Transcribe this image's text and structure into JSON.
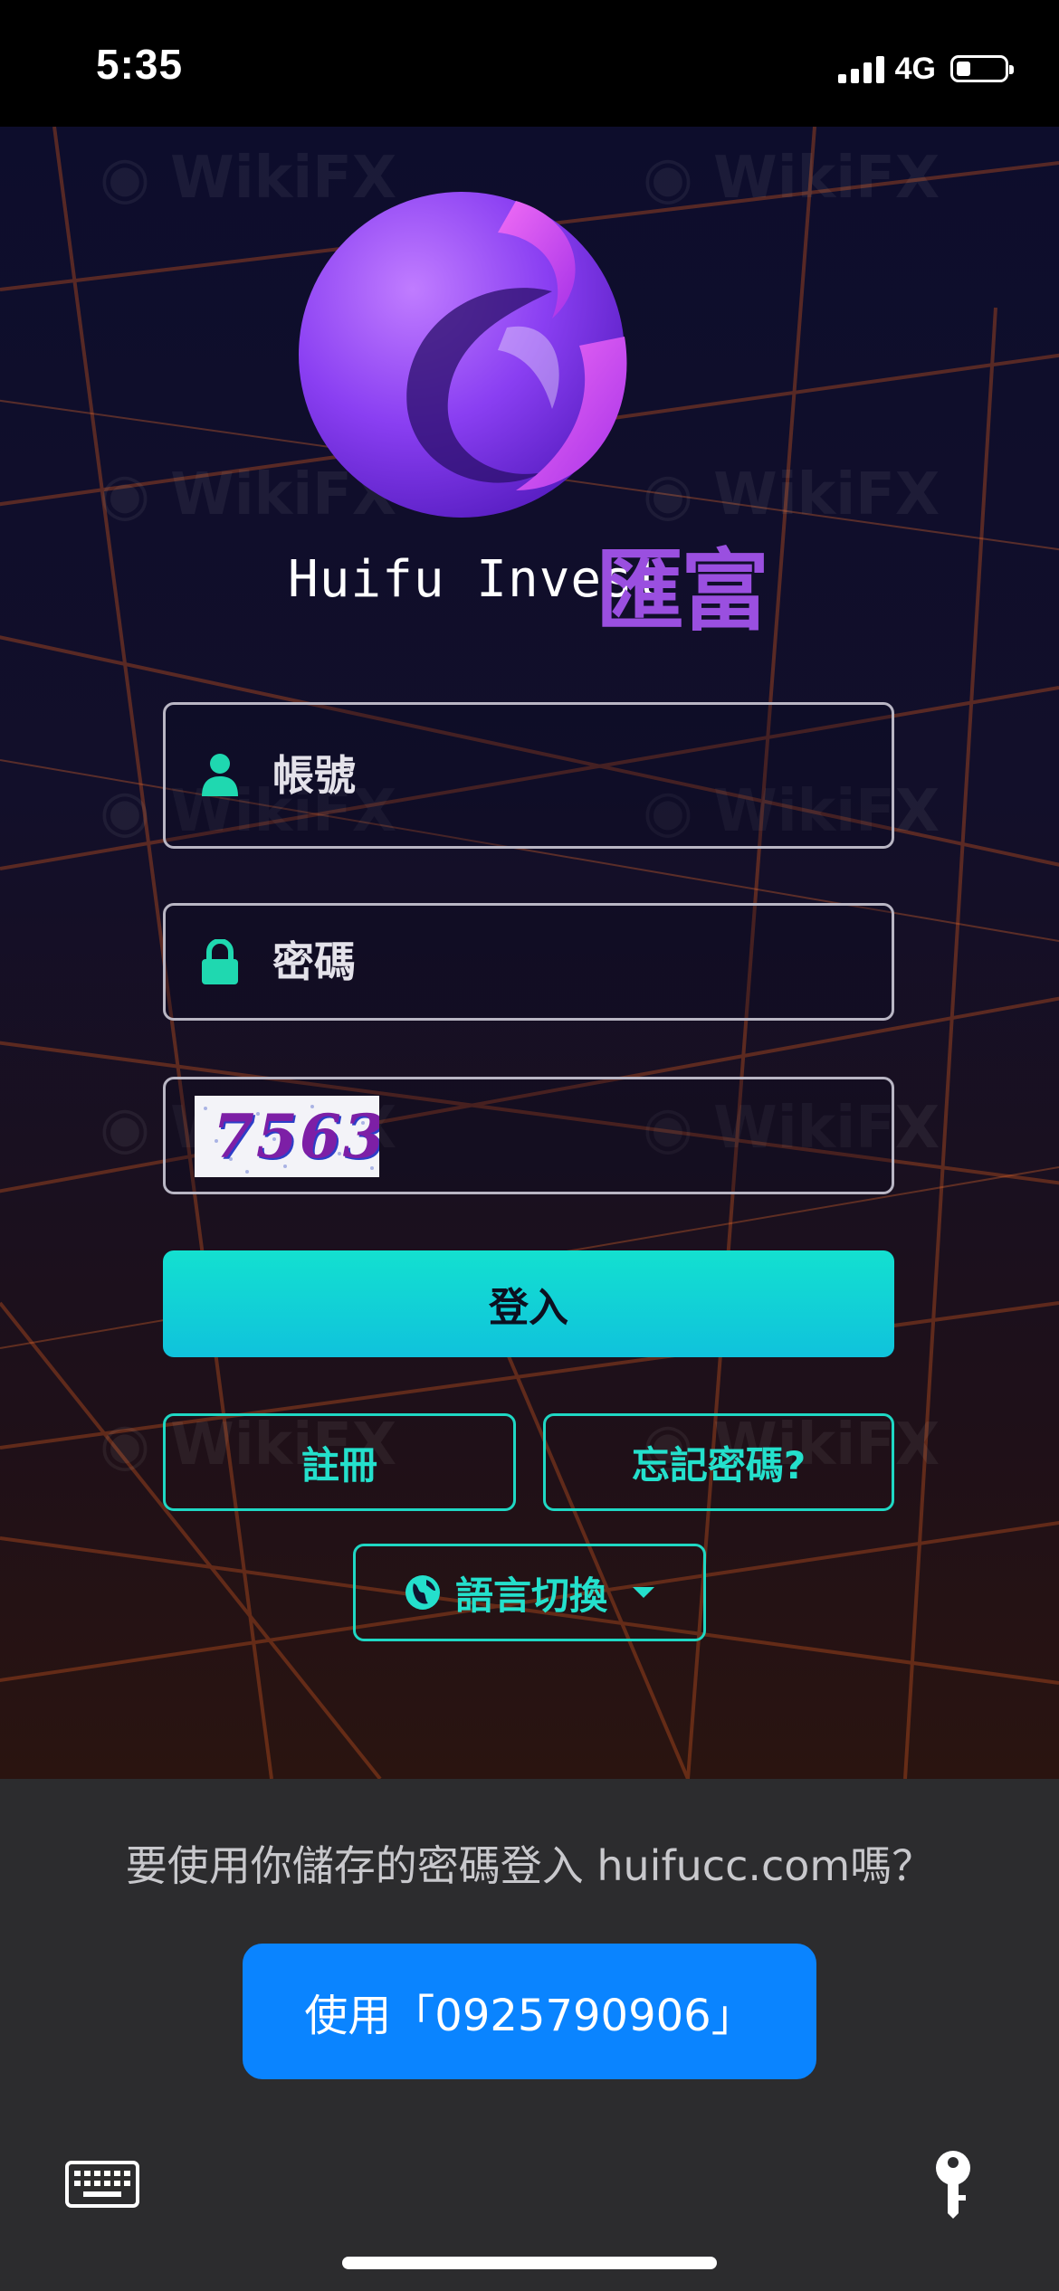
{
  "status_bar": {
    "time": "5:35",
    "network": "4G"
  },
  "brand": {
    "name_en": "Huifu Invest",
    "name_cn": "匯富"
  },
  "form": {
    "account_placeholder": "帳號",
    "password_placeholder": "密碼",
    "captcha_code": "7563",
    "login_label": "登入",
    "register_label": "註冊",
    "forgot_label": "忘記密碼?",
    "language_label": "語言切換"
  },
  "password_prompt": {
    "question": "要使用你儲存的密碼登入 huifucc.com嗎？",
    "use_button": "使用「0925790906」"
  },
  "colors": {
    "accent": "#13e0d0",
    "brand_purple": "#9a4fe0",
    "system_blue": "#0a84ff"
  },
  "icons": [
    "user-icon",
    "lock-icon",
    "globe-icon",
    "caret-down-icon",
    "keyboard-icon",
    "key-icon"
  ]
}
